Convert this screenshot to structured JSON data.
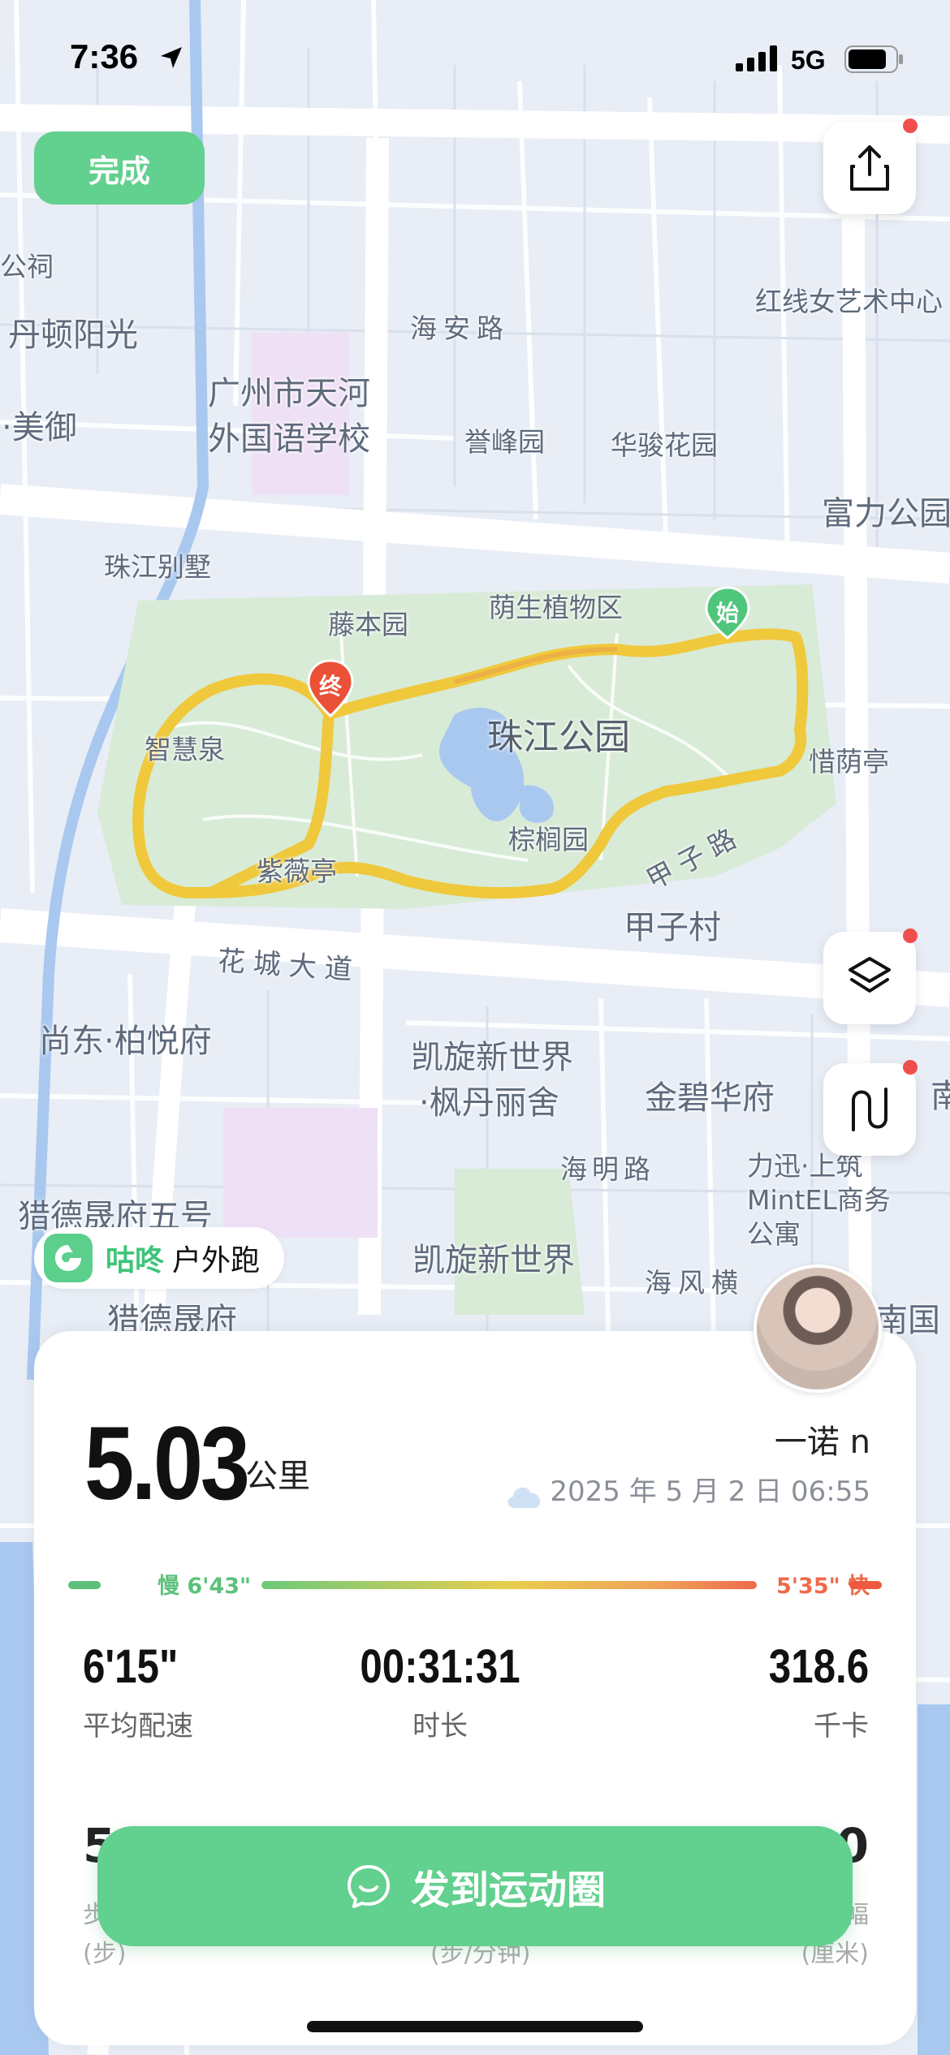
{
  "status_bar": {
    "time": "7:36",
    "network": "5G"
  },
  "top": {
    "done_label": "完成"
  },
  "map": {
    "labels": {
      "haian_road": "海安路",
      "dandun": "丹顿阳光",
      "meiyu": "·美御",
      "school_line1": "广州市天河",
      "school_line2": "外国语学校",
      "yufeng": "誉峰园",
      "huajun": "华骏花园",
      "fuli": "富力公园",
      "zhujiang_villa": "珠江别墅",
      "hongxian": "红线女艺术中心",
      "gongci": "公祠",
      "tengben": "藤本园",
      "yinsheng": "荫生植物区",
      "zhihui": "智慧泉",
      "park_name": "珠江公园",
      "zongly": "棕榈园",
      "ziwei": "紫薇亭",
      "xiyin": "惜荫亭",
      "jiazi_road": "甲子路",
      "jiazi_cun": "甲子村",
      "huacheng": "花城大道",
      "shangdong": "尚东·柏悦府",
      "kaixuan1_l1": "凯旋新世界",
      "kaixuan1_l2": "·枫丹丽舍",
      "jinbi": "金碧华府",
      "haiming": "海明路",
      "lixun_l1": "力迅·上筑",
      "lixun_l2": "MintEL商务",
      "lixun_l3": "公寓",
      "liede5": "猎德晟府五号",
      "kaixuan2": "凯旋新世界",
      "haifeng": "海风横",
      "liede": "猎德晟府",
      "nan": "南",
      "nanguo": "南国"
    },
    "start_marker": "始",
    "end_marker": "终"
  },
  "brand": {
    "name": "咕咚",
    "sport": "户外跑"
  },
  "summary": {
    "distance": "5.03",
    "distance_unit": "公里",
    "username": "一诺 n",
    "datetime": "2025 年 5 月 2 日 06:55",
    "weather_icon": "cloud-icon",
    "pace_slow": "慢 6'43\"",
    "pace_fast": "5'35\" 快"
  },
  "stats": [
    {
      "value": "6'15\"",
      "label": "平均配速"
    },
    {
      "value": "00:31:31",
      "label": "时长"
    },
    {
      "value": "318.6",
      "label": "千卡"
    }
  ],
  "partial_row": {
    "left_value": "5",
    "left_label_1": "步",
    "left_label_2": "(步)",
    "mid_label": "(步/分钟)",
    "right_value": "0",
    "right_label_1": "幅",
    "right_label_2": "(厘米)"
  },
  "share": {
    "label": "发到运动圈"
  },
  "colors": {
    "accent": "#62d08e",
    "route": "#f0c83c",
    "fast": "#ee5a3f",
    "slow": "#5cc07b"
  }
}
